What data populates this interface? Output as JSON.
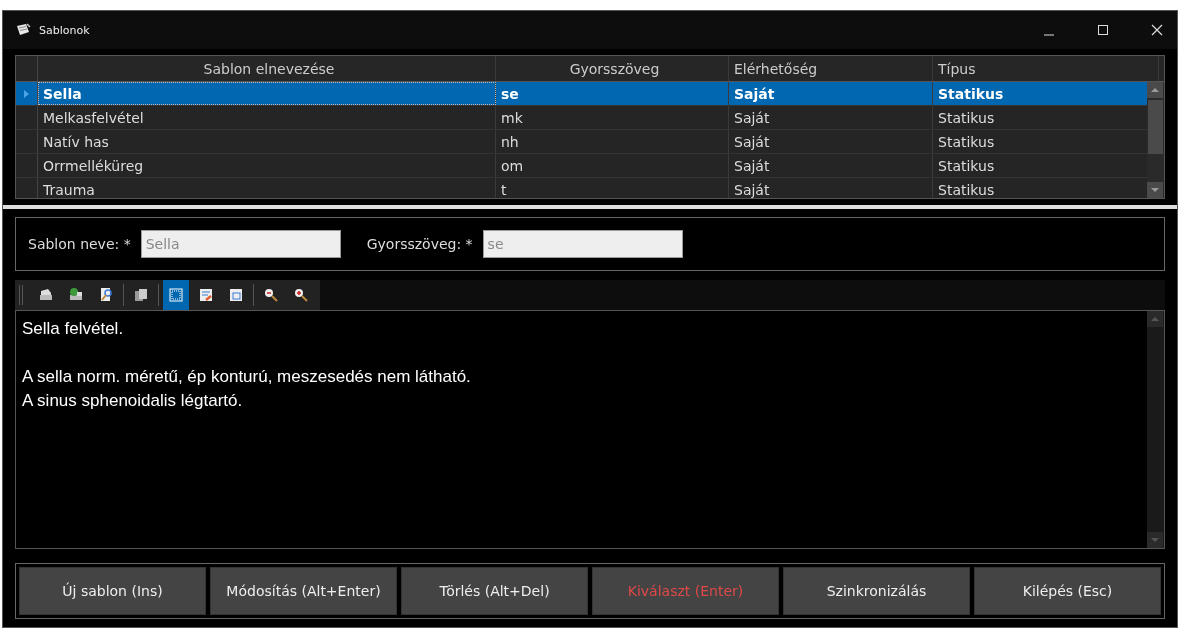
{
  "window": {
    "title": "Sablonok"
  },
  "table": {
    "columns": [
      "Sablon elnevezése",
      "Gyorsszöveg",
      "Elérhetőség",
      "Típus"
    ],
    "rows": [
      {
        "cells": [
          "Sella",
          "se",
          "Saját",
          "Statikus"
        ],
        "selected": true
      },
      {
        "cells": [
          "Melkasfelvétel",
          "mk",
          "Saját",
          "Statikus"
        ],
        "selected": false
      },
      {
        "cells": [
          "Natív has",
          "nh",
          "Saját",
          "Statikus"
        ],
        "selected": false
      },
      {
        "cells": [
          "Orrmelléküreg",
          "om",
          "Saját",
          "Statikus"
        ],
        "selected": false
      },
      {
        "cells": [
          "Trauma",
          "t",
          "Saját",
          "Statikus"
        ],
        "selected": false
      }
    ]
  },
  "form": {
    "fields": [
      {
        "label": "Sablon neve: *",
        "value": "Sella"
      },
      {
        "label": "Gyorsszöveg: *",
        "value": "se"
      }
    ]
  },
  "toolbar": [
    {
      "kind": "print",
      "selected": false
    },
    {
      "kind": "print-help",
      "selected": false
    },
    {
      "kind": "preview",
      "selected": false
    },
    {
      "kind": "sep"
    },
    {
      "kind": "copy",
      "selected": false
    },
    {
      "kind": "sep"
    },
    {
      "kind": "page",
      "selected": true
    },
    {
      "kind": "edit",
      "selected": false
    },
    {
      "kind": "frame",
      "selected": false
    },
    {
      "kind": "sep"
    },
    {
      "kind": "zoom-out",
      "selected": false
    },
    {
      "kind": "zoom-in",
      "selected": false
    }
  ],
  "editor": {
    "paragraphs": [
      {
        "lines": [
          "Sella felvétel."
        ]
      },
      {
        "lines": [
          "A sella norm. méretű, ép konturú, meszesedés nem látható.",
          "A sinus sphenoidalis légtartó."
        ]
      }
    ]
  },
  "buttons": [
    {
      "label": "Új sablon (Ins)",
      "kind": "normal"
    },
    {
      "label": "Módosítás (Alt+Enter)",
      "kind": "normal"
    },
    {
      "label": "Törlés (Alt+Del)",
      "kind": "normal"
    },
    {
      "label": "Kiválaszt (Enter)",
      "kind": "accent"
    },
    {
      "label": "Szinkronizálás",
      "kind": "normal"
    },
    {
      "label": "Kilépés (Esc)",
      "kind": "normal"
    }
  ]
}
